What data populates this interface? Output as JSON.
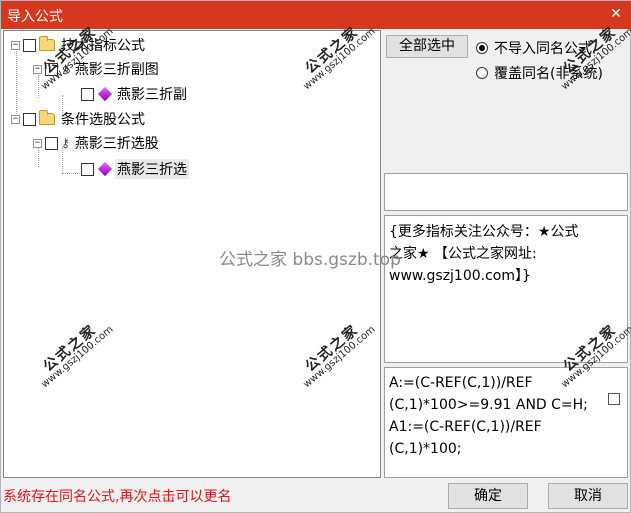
{
  "window": {
    "title": "导入公式",
    "close_glyph": "✕"
  },
  "tree": {
    "items": [
      {
        "expander": "−",
        "label": "技术指标公式",
        "icon": "folder-icon"
      },
      {
        "expander": "−",
        "label": "燕影三折副图",
        "icon": "key-icon"
      },
      {
        "label": "燕影三折副",
        "icon": "gem-icon"
      },
      {
        "expander": "−",
        "label": "条件选股公式",
        "icon": "folder-icon"
      },
      {
        "expander": "−",
        "label": "燕影三折选股",
        "icon": "key-icon"
      },
      {
        "label": "燕影三折选",
        "icon": "gem-icon"
      }
    ]
  },
  "options": {
    "select_all_label": "全部选中",
    "radio_no_import": "不导入同名公式",
    "radio_overwrite": "覆盖同名(非系统)",
    "selected_radio": "no_import"
  },
  "info": {
    "line1": "{更多指标关注公众号：★公式",
    "line2": "之家★ 【公式之家网址:",
    "line3": "www.gszj100.com】}"
  },
  "formula": {
    "text": "A:=(C-REF(C,1))/REF\n(C,1)*100>=9.91  AND C=H;\nA1:=(C-REF(C,1))/REF\n(C,1)*100;"
  },
  "status": {
    "message": "系统存在同名公式,再次点击可以更名"
  },
  "buttons": {
    "ok": "确定",
    "cancel": "取消"
  },
  "watermarks": {
    "name": "公式之家",
    "url": "www.gszj100.com"
  },
  "center_watermark": "公式之家 bbs.gszb.top"
}
